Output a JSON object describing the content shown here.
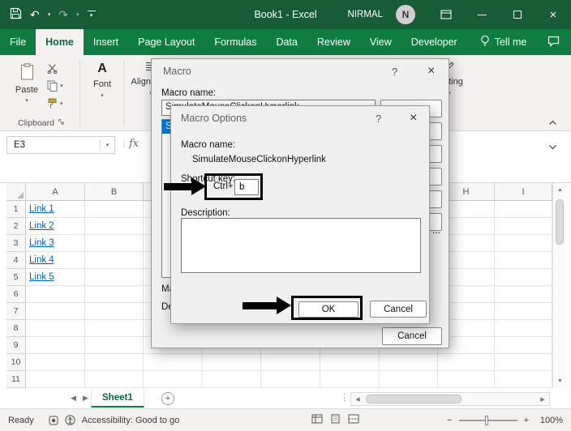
{
  "colors": {
    "title_green": "#185C37",
    "ribbon_green": "#107C41",
    "link_blue": "#0563C1",
    "selection_blue": "#0078D7"
  },
  "glyphs": {
    "caret_down": "▾",
    "close": "×",
    "help": "?",
    "undo": "↶",
    "redo": "↷",
    "dots_v": "⋮",
    "plus": "+",
    "minus": "−",
    "left": "◀",
    "right": "▶",
    "up": "▲",
    "down": "▼",
    "add": "+"
  },
  "titlebar": {
    "title": "Book1 - Excel",
    "user": "NIRMAL",
    "avatar_initial": "N"
  },
  "ribbon_tabs": {
    "items": [
      {
        "label": "File"
      },
      {
        "label": "Home"
      },
      {
        "label": "Insert"
      },
      {
        "label": "Page Layout"
      },
      {
        "label": "Formulas"
      },
      {
        "label": "Data"
      },
      {
        "label": "Review"
      },
      {
        "label": "View"
      },
      {
        "label": "Developer"
      }
    ],
    "tell_me": "Tell me"
  },
  "ribbon": {
    "paste": "Paste",
    "clipboard_group": "Clipboard",
    "font_icon_letter": "A",
    "font_group": "Font",
    "alignment_group": "Alignment",
    "editing_group": "Editing"
  },
  "formula_bar": {
    "name_box": "E3",
    "fx_label": "fx"
  },
  "grid": {
    "columns_left": [
      "A",
      "B"
    ],
    "columns_right": [
      "H",
      "I"
    ],
    "rows": [
      "1",
      "2",
      "3",
      "4",
      "5",
      "6",
      "7",
      "8",
      "9",
      "10",
      "11"
    ],
    "links": [
      "Link 1",
      "Link 2",
      "Link 3",
      "Link 4",
      "Link 5"
    ]
  },
  "macro_dialog": {
    "title": "Macro",
    "macro_name_label": "Macro name:",
    "macro_name_value": "SimulateMouseClickonHyperlink",
    "selected_macro": "SimulateMouseClickonHyperlink",
    "macros_in_label": "Macros in:",
    "description_label": "Description:",
    "options_ellipsis": "...",
    "cancel": "Cancel"
  },
  "macro_options": {
    "title": "Macro Options",
    "macro_name_label": "Macro name:",
    "macro_name_value": "SimulateMouseClickonHyperlink",
    "shortcut_label": "Shortcut key:",
    "shortcut_prefix": "Ctrl+",
    "shortcut_value": "b",
    "description_label": "Description:",
    "ok": "OK",
    "cancel": "Cancel"
  },
  "sheet_bar": {
    "sheet_name": "Sheet1"
  },
  "status_bar": {
    "ready": "Ready",
    "accessibility": "Accessibility: Good to go",
    "zoom_level": "100%"
  }
}
